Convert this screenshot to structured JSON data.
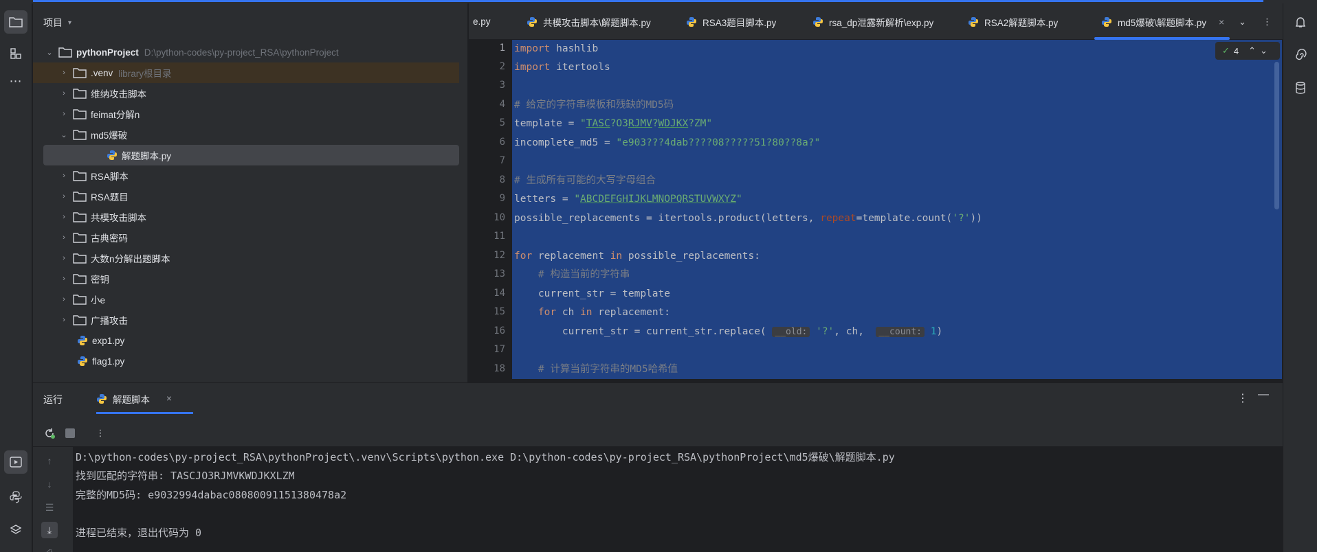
{
  "project_panel": {
    "title": "项目",
    "root_name": "pythonProject",
    "root_path": "D:\\python-codes\\py-project_RSA\\pythonProject",
    "venv_hint": "library根目录",
    "items": [
      {
        "label": ".venv",
        "type": "folder",
        "expanded": false
      },
      {
        "label": "维纳攻击脚本",
        "type": "folder",
        "expanded": false
      },
      {
        "label": "feimat分解n",
        "type": "folder",
        "expanded": false
      },
      {
        "label": "md5爆破",
        "type": "folder",
        "expanded": true
      },
      {
        "label": "解题脚本.py",
        "type": "python-file",
        "selected": true
      },
      {
        "label": "RSA脚本",
        "type": "folder",
        "expanded": false
      },
      {
        "label": "RSA题目",
        "type": "folder",
        "expanded": false
      },
      {
        "label": "共模攻击脚本",
        "type": "folder",
        "expanded": false
      },
      {
        "label": "古典密码",
        "type": "folder",
        "expanded": false
      },
      {
        "label": "大数n分解出题脚本",
        "type": "folder",
        "expanded": false
      },
      {
        "label": "密钥",
        "type": "folder",
        "expanded": false
      },
      {
        "label": "小e",
        "type": "folder",
        "expanded": false
      },
      {
        "label": "广播攻击",
        "type": "folder",
        "expanded": false
      },
      {
        "label": "exp1.py",
        "type": "python-file"
      },
      {
        "label": "flag1.py",
        "type": "python-file"
      }
    ]
  },
  "editor": {
    "tabs": [
      {
        "label": "e.py",
        "active": false
      },
      {
        "label": "共模攻击脚本\\解题脚本.py",
        "active": false
      },
      {
        "label": "RSA3题目脚本.py",
        "active": false
      },
      {
        "label": "rsa_dp泄露新解析\\exp.py",
        "active": false
      },
      {
        "label": "RSA2解题脚本.py",
        "active": false
      },
      {
        "label": "md5爆破\\解题脚本.py",
        "active": true
      }
    ],
    "inspection_count": "4",
    "line_numbers": [
      "1",
      "2",
      "3",
      "4",
      "5",
      "6",
      "7",
      "8",
      "9",
      "10",
      "11",
      "12",
      "13",
      "14",
      "15",
      "16",
      "17",
      "18"
    ],
    "inlay_old": "__old:",
    "inlay_count": "__count:",
    "code": {
      "l1_kw": "import",
      "l1_rest": " hashlib",
      "l2_kw": "import",
      "l2_rest": " itertools",
      "l4": "# 给定的字符串模板和残缺的MD5码",
      "l5_a": "template = ",
      "l5_s1": "\"",
      "l5_u1": "TASC",
      "l5_s2": "?O3",
      "l5_u2": "RJMV",
      "l5_s3": "?",
      "l5_u3": "WDJKX",
      "l5_s4": "?ZM\"",
      "l6_a": "incomplete_md5 = ",
      "l6_s": "\"e903???4dab????08?????51?80??8a?\"",
      "l8": "# 生成所有可能的大写字母组合",
      "l9_a": "letters = ",
      "l9_s1": "\"",
      "l9_u": "ABCDEFGHIJKLMNOPQRSTUVWXYZ",
      "l9_s2": "\"",
      "l10_a": "possible_replacements = itertools.product(letters, ",
      "l10_p": "repeat",
      "l10_b": "=template.count(",
      "l10_s": "'?'",
      "l10_c": "))",
      "l12_kw1": "for",
      "l12_a": " replacement ",
      "l12_kw2": "in",
      "l12_b": " possible_replacements:",
      "l13": "    # 构造当前的字符串",
      "l14": "    current_str = template",
      "l15_i": "    ",
      "l15_kw1": "for",
      "l15_a": " ch ",
      "l15_kw2": "in",
      "l15_b": " replacement:",
      "l16_a": "        current_str = current_str.replace( ",
      "l16_s": " '?'",
      "l16_b": ", ch,  ",
      "l16_n": " 1",
      "l16_c": ")",
      "l18": "    # 计算当前字符串的MD5哈希值"
    }
  },
  "run_panel": {
    "title": "运行",
    "tab_label": "解题脚本",
    "output": [
      "D:\\python-codes\\py-project_RSA\\pythonProject\\.venv\\Scripts\\python.exe D:\\python-codes\\py-project_RSA\\pythonProject\\md5爆破\\解题脚本.py",
      "找到匹配的字符串: TASCJO3RJMVKWDJKXLZM",
      "完整的MD5码: e9032994dabac08080091151380478a2",
      "",
      "进程已结束，退出代码为 0"
    ]
  },
  "colors": {
    "accent": "#3574f0",
    "selection": "#214283",
    "keyword": "#cf8e6d",
    "string": "#6aab73",
    "comment": "#7a7e85"
  }
}
